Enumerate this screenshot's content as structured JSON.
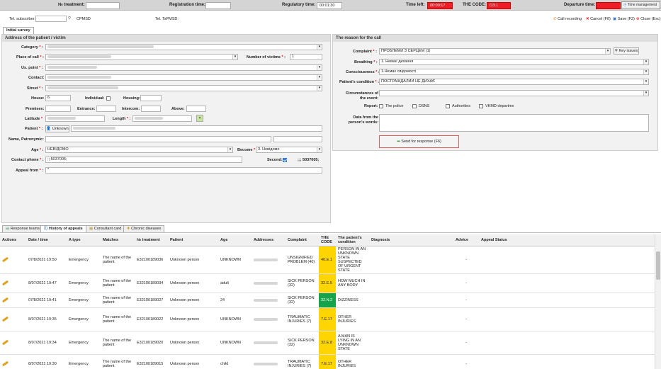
{
  "topbar": {
    "treatment_label": "№ treatment:",
    "registration_label": "Registration time:",
    "regulatory_label": "Regulatory time:",
    "regulatory_value": "00:01:30",
    "time_left_label": "Time left:",
    "time_left_value": "00:00:17",
    "code_label": "THE CODE:",
    "code_value": "ОЗ.1",
    "departure_label": "Departure time:",
    "time_management": "Time management"
  },
  "subbar": {
    "tel_subscriber_label": "Tel. subscriber:",
    "cpmsd_label": "CPMSD",
    "tel_tsmsd_label": "Tel. TsPMSD:",
    "call_recording": "Call recording",
    "cancel": "Cancel (F8)",
    "save": "Save (F2)",
    "close": "Close (Esc)",
    "initial_survey_tab": "Initial survey"
  },
  "address": {
    "header": "Address of the patient / victim",
    "category_label": "Category",
    "place_label": "Place of call",
    "victims_label": "Number of victims",
    "victims_value": "1",
    "us_point_label": "Us. point",
    "contact_label": "Contact:",
    "street_label": "Street",
    "house_label": "House:",
    "house_value": "6",
    "individual_label": "Individual:",
    "housing_label": "Housing:",
    "premises_label": "Premises:",
    "entrance_label": "Entrance:",
    "intercom_label": "Intercom:",
    "above_label": "Above:",
    "latitude_label": "Latitude",
    "length_label": "Length",
    "patient_label": "Patient",
    "patient_unknown": "Unknown",
    "name_label": "Name, Patronymic:",
    "age_label": "Age",
    "age_value": "НЕВІДОМО",
    "become_label": "Become",
    "become_value": "3. Невідомо",
    "contact_phone_label": "Contact phone",
    "contact_phone_value": ";;;5037005;",
    "second_label": "Second:",
    "second_value": ";;; 5037005;",
    "appeal_label": "Appeal from",
    "appeal_value": "*"
  },
  "reason": {
    "header": "The reason for the call",
    "complaint_label": "Complaint",
    "complaint_value": "ПРОБЛЕМИ З СЕРЦЕМ (1)",
    "key_issues": "Key issues",
    "breathing_label": "Breathing",
    "breathing_value": "1. Немає дихання",
    "consciousness_label": "Consciousness",
    "consciousness_value": "1.Немає свідомості",
    "condition_label": "Patient's condition",
    "condition_value": "ПОСТРАЖДАЛИЙ НЕ ДИХАЄ",
    "circumstances_label": "Circumstances of the event:",
    "report_label": "Report:",
    "report_options": [
      "The police",
      "DSNS",
      "Authorities",
      "VKMD departmx"
    ],
    "data_words_label": "Data from the person's words:",
    "send_button": "Send for response (F6)"
  },
  "bottom_tabs": [
    "Response teams",
    "History of appeals",
    "Consultant card",
    "Chronic diseases"
  ],
  "grid": {
    "columns": [
      "Actions",
      "Date / time",
      "A type",
      "Matches",
      "№ treatment",
      "Patient",
      "Age",
      "Addresses",
      "Complaint",
      "THE CODE",
      "The patient's condition",
      "Diagnosis",
      "Advice",
      "Appeal Status"
    ],
    "rows": [
      {
        "date": "07/8/2021 19:50",
        "type": "Emergency",
        "matches": "The name of the patient",
        "treatment": "E32100189036",
        "patient": "Unknown person",
        "age": "UNKNOWN",
        "complaint": "UNSIGNIFIED PROBLEM (40)",
        "code": "40.E.1",
        "code_color": "y",
        "condition": "PERSON IN AN UNKNOWN STATE SUSPECTED OF URGENT STATE",
        "advice": "-"
      },
      {
        "date": "8/07/2021 19:47",
        "type": "Emergency",
        "matches": "The name of the patient",
        "treatment": "E32100189034",
        "patient": "Unknown person",
        "age": "adult",
        "complaint": "SICK PERSON (32)",
        "code": "32.E.5",
        "code_color": "y",
        "condition": "HOW MUCH IN ANY BODY",
        "advice": "-"
      },
      {
        "date": "07/8/2021 19:41",
        "type": "Emergency",
        "matches": "The name of the patient",
        "treatment": "E32100189027",
        "patient": "Unknown person",
        "age": "24",
        "complaint": "SICK PERSON (32)",
        "code": "32.N.2",
        "code_color": "g",
        "condition": "DIZZINESS",
        "advice": "-"
      },
      {
        "date": "8/07/2021 19:35",
        "type": "Emergency",
        "matches": "The name of the patient",
        "treatment": "E32100189022",
        "patient": "Unknown person",
        "age": "UNKNOWN",
        "complaint": "TRAUMATIC INJURIES (7)",
        "code": "7.E.17",
        "code_color": "y",
        "condition": "OTHER INJURIES",
        "advice": "-"
      },
      {
        "date": "8/07/2021 19:34",
        "type": "Emergency",
        "matches": "The name of the patient",
        "treatment": "E32100189020",
        "patient": "Unknown person",
        "age": "UNKNOWN",
        "complaint": "SICK PERSON (32)",
        "code": "32.E.8",
        "code_color": "y",
        "condition": "A MAN IS LYING IN AN UNKNOWN STATE",
        "advice": "-"
      },
      {
        "date": "8/07/2021 19:30",
        "type": "Emergency",
        "matches": "The name of the patient",
        "treatment": "E32100189015",
        "patient": "Unknown person",
        "age": "child",
        "complaint": "TRAUMATIC INJURIES (7)",
        "code": "7.E.17",
        "code_color": "y",
        "condition": "OTHER INJURIES",
        "advice": "-"
      }
    ]
  }
}
